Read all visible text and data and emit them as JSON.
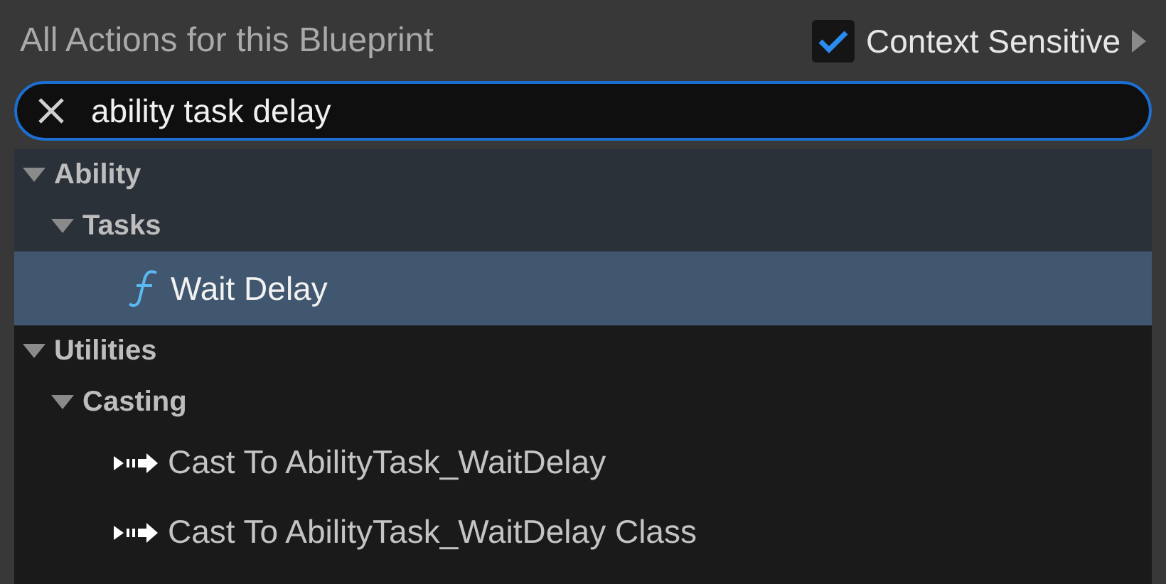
{
  "header": {
    "title": "All Actions for this Blueprint",
    "context_sensitive": {
      "label": "Context Sensitive",
      "checked": true
    }
  },
  "search": {
    "value": "ability task delay"
  },
  "tree": [
    {
      "kind": "category",
      "label": "Ability",
      "expanded": true,
      "children": [
        {
          "kind": "category",
          "label": "Tasks",
          "expanded": true,
          "children": [
            {
              "kind": "function",
              "label": "Wait Delay",
              "selected": true
            }
          ]
        }
      ]
    },
    {
      "kind": "category",
      "label": "Utilities",
      "expanded": true,
      "children": [
        {
          "kind": "category",
          "label": "Casting",
          "expanded": true,
          "children": [
            {
              "kind": "cast",
              "label": "Cast To AbilityTask_WaitDelay",
              "selected": false
            },
            {
              "kind": "cast",
              "label": "Cast To AbilityTask_WaitDelay Class",
              "selected": false
            }
          ]
        }
      ]
    }
  ]
}
